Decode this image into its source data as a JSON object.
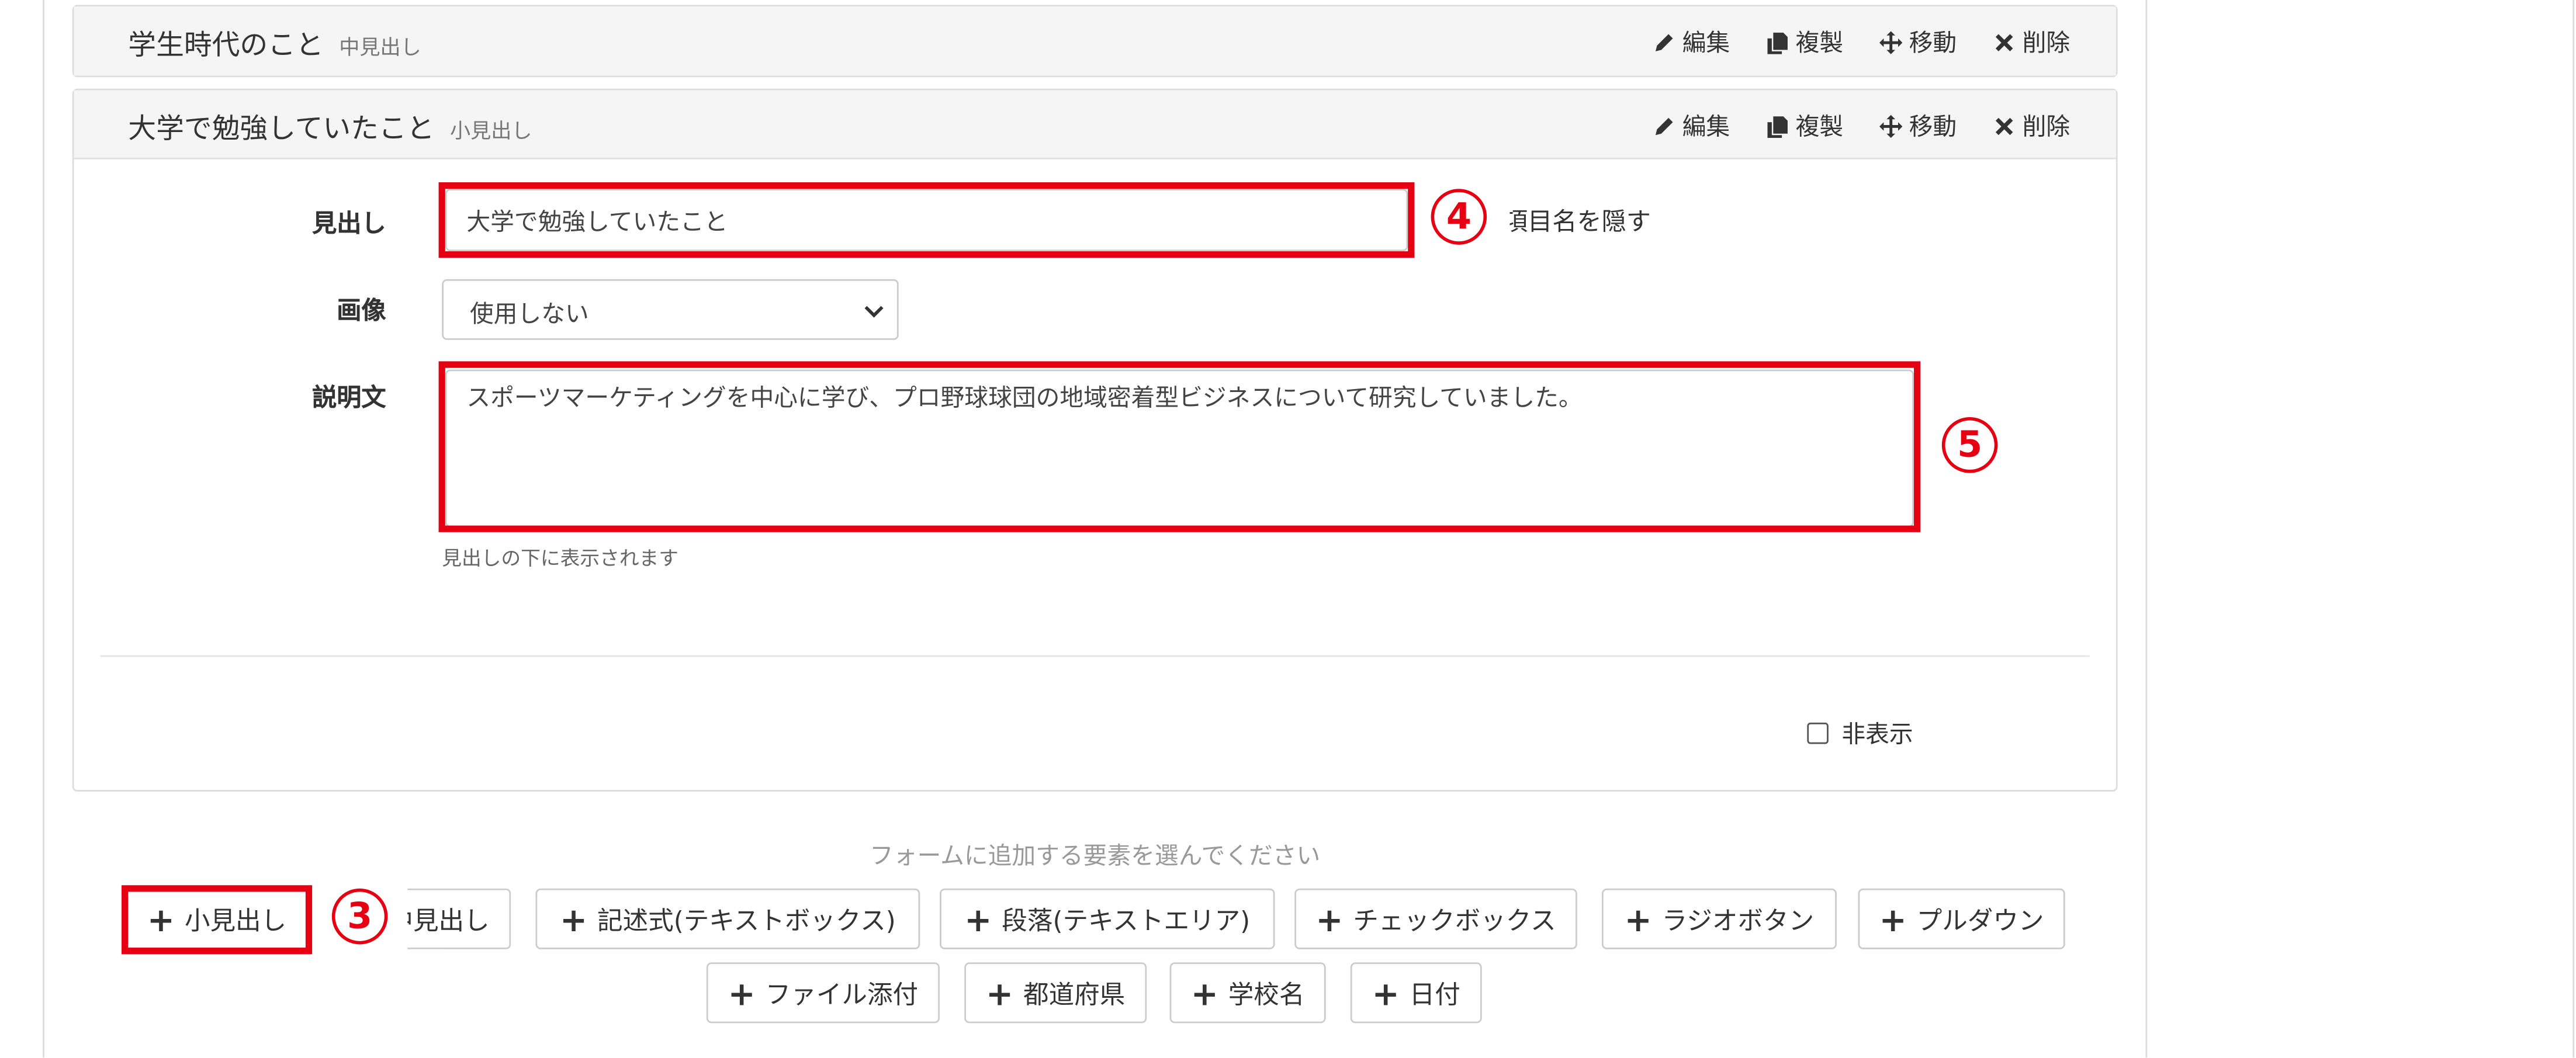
{
  "sections": [
    {
      "title": "学生時代のこと",
      "type": "中見出し"
    },
    {
      "title": "大学で勉強していたこと",
      "type": "小見出し"
    }
  ],
  "actions": {
    "edit": "編集",
    "duplicate": "複製",
    "move": "移動",
    "delete": "削除"
  },
  "form": {
    "heading_label": "見出し",
    "heading_value": "大学で勉強していたこと",
    "hide_label_text": "項目名を隠す",
    "image_label": "画像",
    "image_selected": "使用しない",
    "description_label": "説明文",
    "description_value": "スポーツマーケティングを中心に学び、プロ野球球団の地域密着型ビジネスについて研究していました。",
    "description_hint": "見出しの下に表示されます",
    "hidden_label": "非表示"
  },
  "annotations": {
    "marker_3": "3",
    "marker_4": "4",
    "marker_5": "5",
    "accent": "#e60012"
  },
  "add_elements": {
    "prompt": "フォームに追加する要素を選んでください",
    "buttons": [
      "小見出し",
      "中見出し",
      "記述式(テキストボックス)",
      "段落(テキストエリア)",
      "チェックボックス",
      "ラジオボタン",
      "プルダウン",
      "ファイル添付",
      "都道府県",
      "学校名",
      "日付"
    ]
  }
}
